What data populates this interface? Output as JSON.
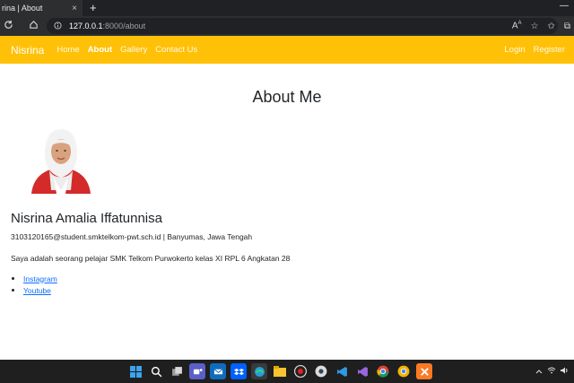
{
  "browser": {
    "tab_title": "rina | About",
    "tab_close": "×",
    "new_tab": "+",
    "window_minimize": "—",
    "url_host": "127.0.0.1",
    "url_path": ":8000/about"
  },
  "navbar": {
    "brand": "Nisrina",
    "links": [
      {
        "label": "Home"
      },
      {
        "label": "About"
      },
      {
        "label": "Gallery"
      },
      {
        "label": "Contact Us"
      }
    ],
    "right_links": [
      {
        "label": "Login"
      },
      {
        "label": "Register"
      }
    ],
    "bg_color": "#ffc107"
  },
  "page": {
    "title": "About Me",
    "name": "Nisrina Amalia Iffatunnisa",
    "contact": "3103120165@student.smktelkom-pwt.sch.id | Banyumas, Jawa Tengah",
    "description": "Saya adalah seorang pelajar SMK Telkom Purwokerto kelas XI RPL 6 Angkatan 28",
    "social_links": [
      {
        "label": "Instagram"
      },
      {
        "label": "Youtube"
      }
    ]
  },
  "taskbar": {
    "apps": [
      "windows-start-icon",
      "search-icon",
      "task-view-icon",
      "teams-icon",
      "mail-icon",
      "dropbox-icon",
      "edge-icon",
      "file-explorer-icon",
      "obs-icon",
      "steam-icon",
      "vscode-icon",
      "visual-studio-icon",
      "chrome-icon",
      "chrome-canary-icon",
      "xampp-icon"
    ]
  }
}
